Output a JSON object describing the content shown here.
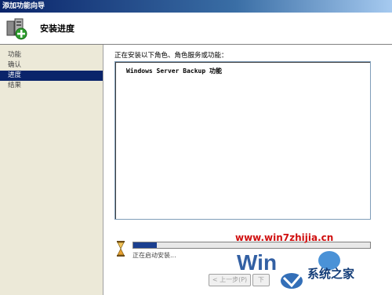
{
  "window": {
    "title": "添加功能向导"
  },
  "header": {
    "title": "安装进度"
  },
  "sidebar": {
    "items": [
      {
        "label": "功能",
        "active": false
      },
      {
        "label": "确认",
        "active": false
      },
      {
        "label": "进度",
        "active": true
      },
      {
        "label": "结果",
        "active": false
      }
    ]
  },
  "main": {
    "instruction": "正在安装以下角色、角色服务或功能：",
    "list_items": [
      "Windows Server Backup 功能"
    ],
    "progress_percent": 10,
    "status": "正在启动安装..."
  },
  "buttons": {
    "back_label": "< 上一步(P)",
    "next_label": "下"
  },
  "watermark": {
    "url": "www.win7zhijia.cn",
    "site": "系统之家"
  }
}
